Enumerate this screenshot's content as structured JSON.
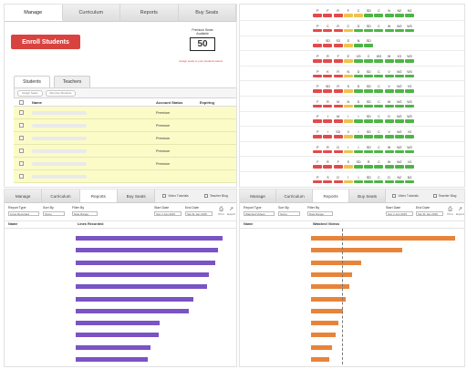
{
  "manage": {
    "tabs": [
      "Manage",
      "Curriculum",
      "Reports",
      "Buy Seats"
    ],
    "active_tab": 0,
    "enroll_button": "Enroll Students",
    "seats": {
      "label_line1": "Premium Seats",
      "label_line2": "Available",
      "count": "50",
      "note": "Assign seats to your students below"
    },
    "roster_tabs": [
      "Students",
      "Teachers"
    ],
    "filters": [
      "Assign Seats",
      "Remove Students"
    ],
    "columns": {
      "name": "Name",
      "status": "Account Status",
      "expiring": "Expiring"
    },
    "rows": [
      "Premium",
      "Premium",
      "Premium",
      "Premium",
      "Premium",
      ""
    ]
  },
  "grid": {
    "colors": {
      "red": "#e14b4b",
      "yellow": "#efc24a",
      "green": "#4fb447"
    },
    "rows": [
      {
        "labels": [
          "P",
          "F",
          "R",
          "F",
          "C",
          "SD",
          "C",
          "N",
          "N2",
          "N3"
        ],
        "colors": [
          "red",
          "red",
          "red",
          "yellow",
          "yellow",
          "green",
          "green",
          "green",
          "green",
          "green"
        ]
      },
      {
        "labels": [
          "P",
          "C",
          "R",
          "C",
          "D",
          "SD",
          "C",
          "W",
          "W2",
          "W3"
        ],
        "colors": [
          "red",
          "red",
          "red",
          "yellow",
          "green",
          "green",
          "green",
          "green",
          "green",
          "green"
        ]
      },
      {
        "labels": [
          "I",
          "SD",
          "S3",
          "S",
          "N",
          "SD"
        ],
        "colors": [
          "red",
          "red",
          "red",
          "yellow",
          "green",
          "green"
        ]
      },
      {
        "labels": [
          "P",
          "R",
          "F",
          "E",
          "VD",
          "C",
          "W3",
          "W",
          "K3",
          "W3"
        ],
        "colors": [
          "red",
          "red",
          "red",
          "yellow",
          "green",
          "green",
          "green",
          "green",
          "green",
          "green"
        ]
      },
      {
        "labels": [
          "P",
          "K",
          "R",
          "N",
          "D",
          "SD",
          "C",
          "V",
          "W2",
          "W3"
        ],
        "colors": [
          "red",
          "red",
          "red",
          "yellow",
          "green",
          "green",
          "green",
          "green",
          "green",
          "green"
        ]
      },
      {
        "labels": [
          "P",
          "SD",
          "R",
          "S",
          "D",
          "SD",
          "C",
          "V",
          "W2",
          "V3"
        ],
        "colors": [
          "red",
          "red",
          "red",
          "yellow",
          "green",
          "green",
          "green",
          "green",
          "green",
          "green"
        ]
      },
      {
        "labels": [
          "F",
          "R",
          "M",
          "N",
          "D",
          "SD",
          "C",
          "W",
          "W2",
          "W3"
        ],
        "colors": [
          "red",
          "red",
          "red",
          "yellow",
          "green",
          "green",
          "green",
          "green",
          "green",
          "green"
        ]
      },
      {
        "labels": [
          "P",
          "I",
          "M",
          "I",
          "I",
          "SD",
          "C",
          "D",
          "W2",
          "W3"
        ],
        "colors": [
          "red",
          "red",
          "red",
          "yellow",
          "green",
          "green",
          "green",
          "green",
          "green",
          "green"
        ]
      },
      {
        "labels": [
          "P",
          "I",
          "SD",
          "V",
          "I",
          "SD",
          "C",
          "V",
          "W2",
          "V3"
        ],
        "colors": [
          "red",
          "red",
          "red",
          "yellow",
          "green",
          "green",
          "green",
          "green",
          "green",
          "green"
        ]
      },
      {
        "labels": [
          "P",
          "R",
          "D",
          "I",
          "I",
          "SD",
          "C",
          "W",
          "W2",
          "W3"
        ],
        "colors": [
          "red",
          "red",
          "red",
          "yellow",
          "green",
          "green",
          "green",
          "green",
          "green",
          "green"
        ]
      },
      {
        "labels": [
          "F",
          "R",
          "F",
          "S",
          "SD",
          "R",
          "C",
          "W",
          "W2",
          "V3"
        ],
        "colors": [
          "red",
          "red",
          "red",
          "yellow",
          "green",
          "green",
          "green",
          "green",
          "green",
          "green"
        ]
      },
      {
        "labels": [
          "P",
          "S",
          "D",
          "I",
          "I",
          "SD",
          "C",
          "D",
          "N2",
          "N3"
        ],
        "colors": [
          "red",
          "red",
          "red",
          "yellow",
          "green",
          "green",
          "green",
          "green",
          "green",
          "green"
        ]
      }
    ]
  },
  "report_lines": {
    "tabs": [
      "Manage",
      "Curriculum",
      "Reports",
      "Buy Seats"
    ],
    "active_tab": 2,
    "options": [
      "Video Tutorials",
      "Teacher Blog"
    ],
    "controls": {
      "report_type": "Report Type",
      "report_type_value": "Lines Recorded",
      "sort_by": "Sort By",
      "sort_value": "Score",
      "filter_by": "Filter By",
      "filter_value": "Date Range",
      "start_date": "Start Date",
      "start_value": "Sun 1 Jan 2015",
      "end_date": "End Date",
      "end_value": "Sat 31 Jan 2015",
      "print": "Print",
      "export": "Export"
    },
    "col_name": "Name",
    "col_metric": "Lines Recorded",
    "bar_color": "#7a53c4"
  },
  "report_videos": {
    "tabs": [
      "Manage",
      "Curriculum",
      "Reports",
      "Buy Seats"
    ],
    "active_tab": 2,
    "options": [
      "Video Tutorials",
      "Teacher Blog"
    ],
    "controls": {
      "report_type": "Report Type",
      "report_type_value": "Watched Videos",
      "sort_by": "Sort By",
      "sort_value": "Score",
      "filter_by": "Filter By",
      "filter_value": "Date Range",
      "start_date": "Start Date",
      "start_value": "Sun 1 Jan 2015",
      "end_date": "End Date",
      "end_value": "Sat 31 Jan 2015",
      "print": "Print",
      "export": "Export"
    },
    "col_name": "Name",
    "col_metric": "Watched Videos",
    "bar_color": "#e8843a"
  },
  "chart_data": [
    {
      "type": "bar",
      "orientation": "horizontal",
      "title": "",
      "xlabel": "Lines Recorded",
      "ylabel": "",
      "series": [
        {
          "values": [
            96,
            93,
            91,
            87,
            86,
            77,
            74,
            55,
            54,
            49,
            47
          ]
        }
      ],
      "xlim": [
        0,
        100
      ],
      "grid": false
    },
    {
      "type": "bar",
      "orientation": "horizontal",
      "title": "",
      "xlabel": "Watched Videos",
      "ylabel": "",
      "series": [
        {
          "values": [
            95,
            60,
            33,
            27,
            25,
            23,
            21,
            18,
            16,
            14,
            12
          ]
        }
      ],
      "xlim": [
        0,
        100
      ],
      "grid": false
    }
  ]
}
